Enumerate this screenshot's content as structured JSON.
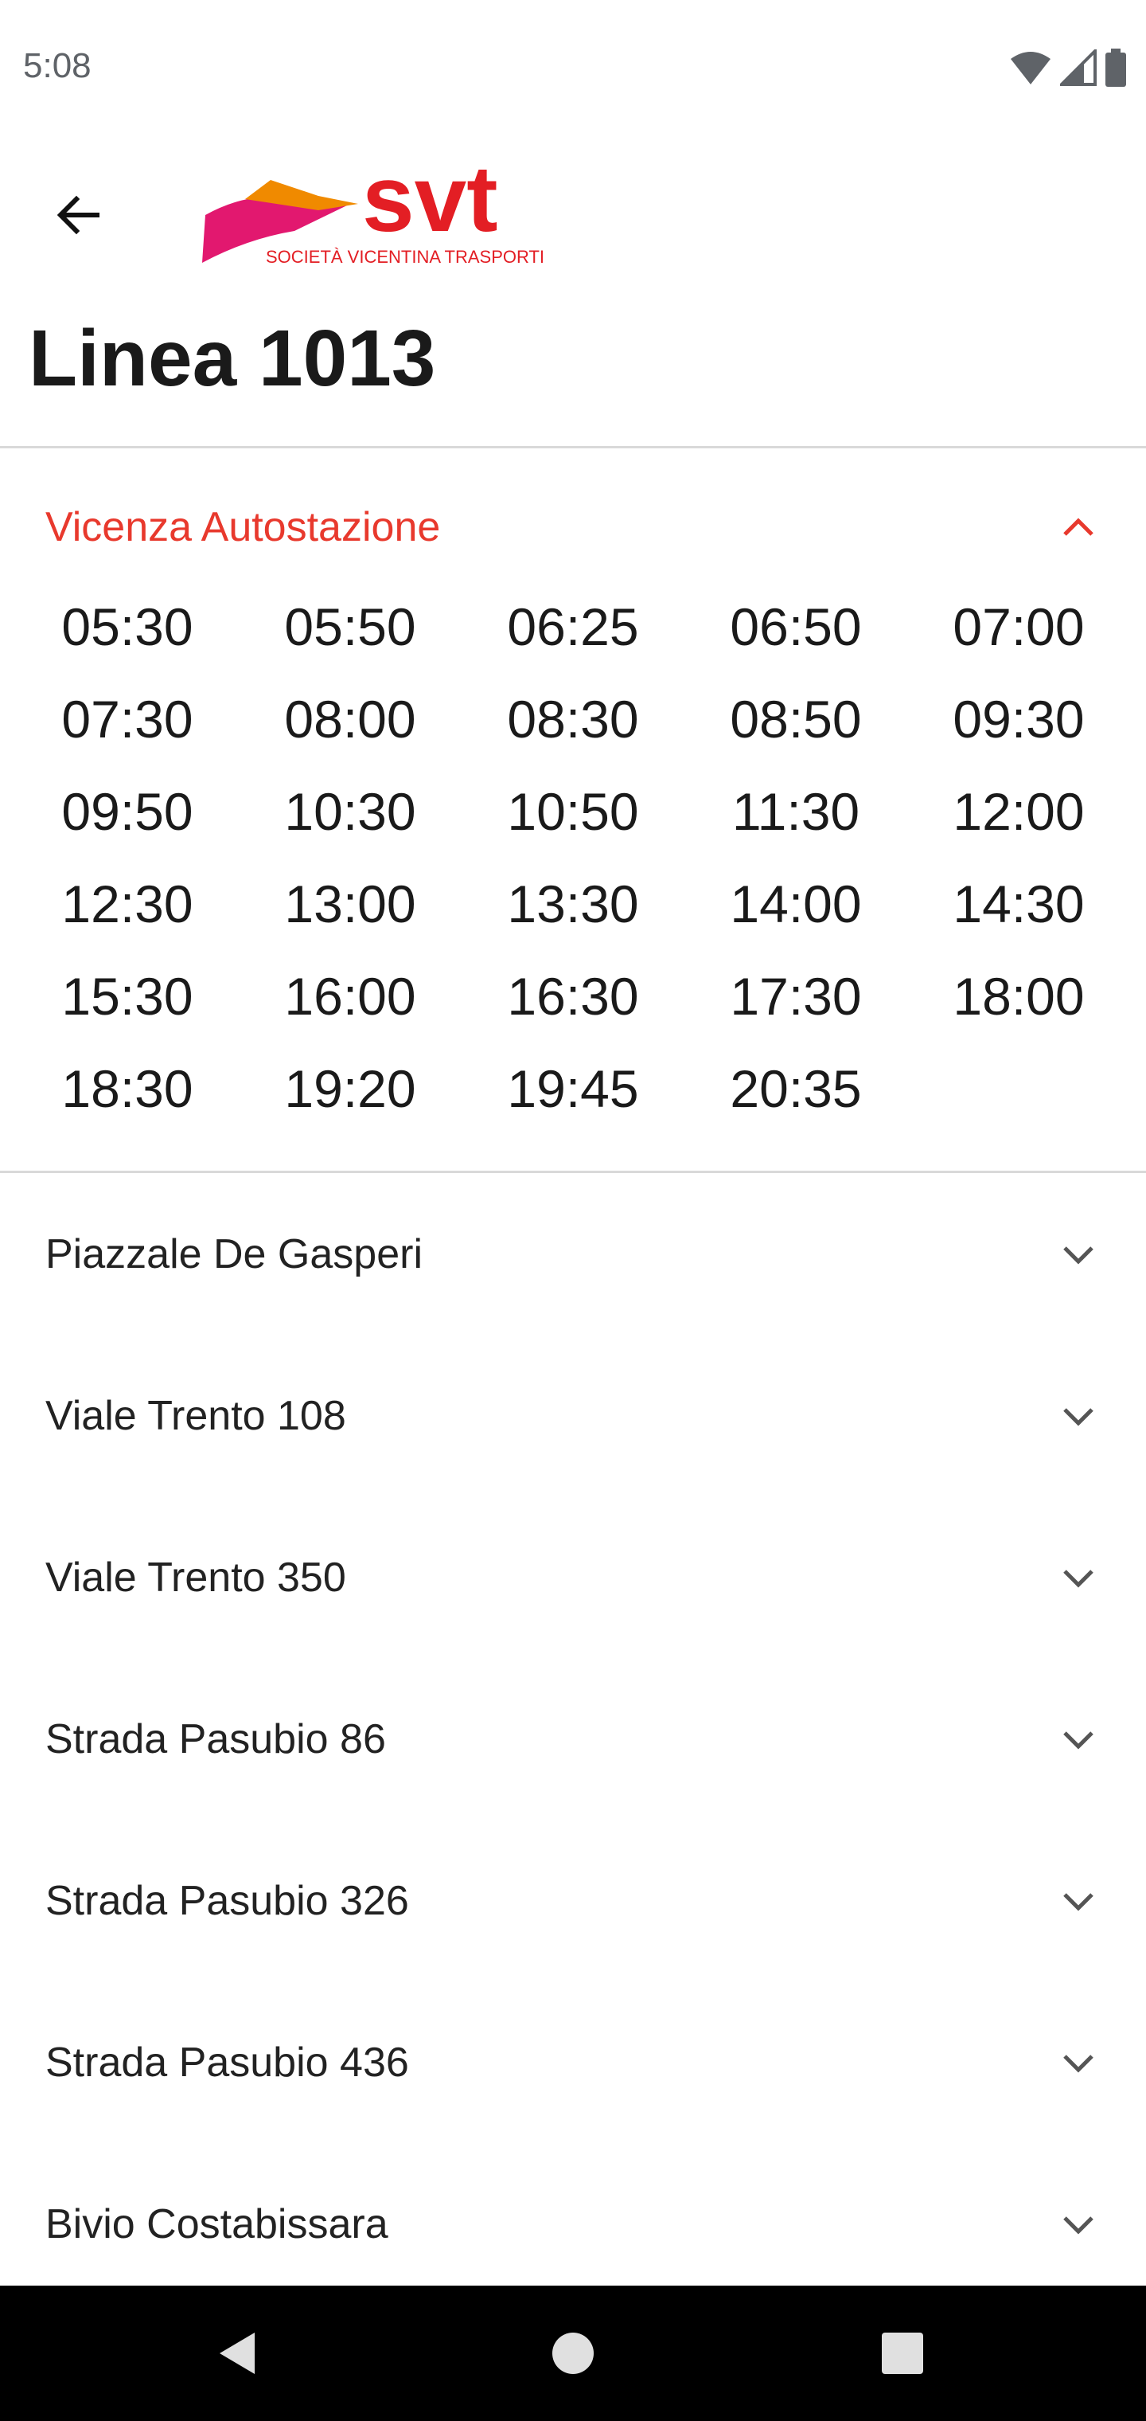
{
  "status_bar": {
    "time": "5:08"
  },
  "header": {
    "back_icon": "arrow-left-icon",
    "logo_text": "svt",
    "logo_subtitle": "SOCIETÀ VICENTINA TRASPORTI",
    "title": "Linea 1013"
  },
  "colors": {
    "accent": "#e8392d",
    "logo_orange": "#f08a00",
    "logo_pink": "#e2186f",
    "logo_red": "#e31e24"
  },
  "expanded_stop": {
    "name": "Vicenza Autostazione",
    "expanded": true,
    "times": [
      "05:30",
      "05:50",
      "06:25",
      "06:50",
      "07:00",
      "07:30",
      "08:00",
      "08:30",
      "08:50",
      "09:30",
      "09:50",
      "10:30",
      "10:50",
      "11:30",
      "12:00",
      "12:30",
      "13:00",
      "13:30",
      "14:00",
      "14:30",
      "15:30",
      "16:00",
      "16:30",
      "17:30",
      "18:00",
      "18:30",
      "19:20",
      "19:45",
      "20:35"
    ]
  },
  "stops": [
    {
      "name": "Piazzale De Gasperi",
      "expanded": false
    },
    {
      "name": "Viale Trento 108",
      "expanded": false
    },
    {
      "name": "Viale Trento 350",
      "expanded": false
    },
    {
      "name": "Strada Pasubio 86",
      "expanded": false
    },
    {
      "name": "Strada Pasubio 326",
      "expanded": false
    },
    {
      "name": "Strada Pasubio 436",
      "expanded": false
    },
    {
      "name": "Bivio Costabissara",
      "expanded": false
    }
  ],
  "nav": {
    "back_icon": "triangle-back-icon",
    "home_icon": "circle-home-icon",
    "recents_icon": "square-recents-icon"
  }
}
